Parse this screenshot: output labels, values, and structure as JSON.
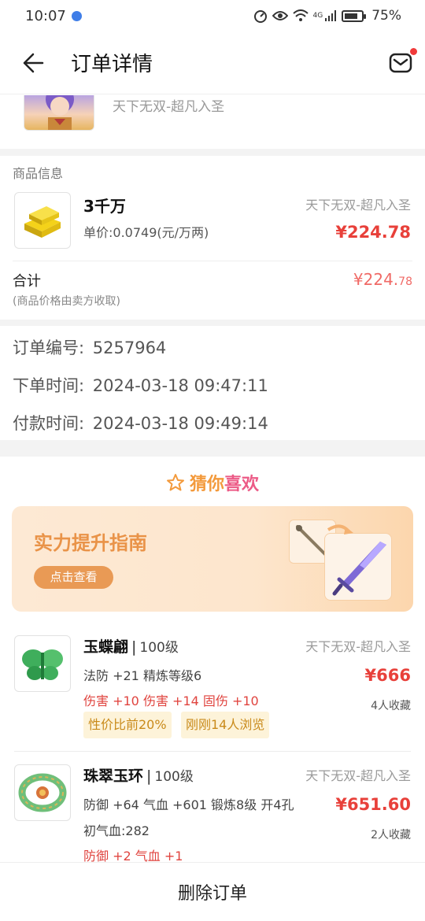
{
  "status_bar": {
    "time": "10:07",
    "network_label": "4G",
    "battery": "75%"
  },
  "nav": {
    "title": "订单详情"
  },
  "top_item": {
    "server": "天下无双-超凡入圣"
  },
  "goods": {
    "section_title": "商品信息",
    "name": "3千万",
    "unit_price": "单价:0.0749(元/万两)",
    "server": "天下无双-超凡入圣",
    "price": "¥224.78",
    "total_label": "合计",
    "total_note": "(商品价格由卖方收取)",
    "total_price_main": "¥224.",
    "total_price_decimal": "78"
  },
  "order": {
    "number_label": "订单编号:",
    "number_value": "5257964",
    "created_label": "下单时间:",
    "created_value": "2024-03-18 09:47:11",
    "paid_label": "付款时间:",
    "paid_value": "2024-03-18 09:49:14"
  },
  "recommend": {
    "title_part1": "猜你",
    "title_part2": "喜欢",
    "banner_title": "实力提升指南",
    "banner_button": "点击查看",
    "products": [
      {
        "name": "玉蝶翩",
        "level": "100级",
        "server": "天下无双-超凡入圣",
        "attr1": "法防 +21 精炼等级6",
        "attr2": "伤害 +10 伤害 +14 固伤 +10",
        "price": "¥666",
        "favorites": "4人收藏",
        "tags": [
          "性价比前20%",
          "刚刚14人浏览"
        ]
      },
      {
        "name": "珠翠玉环",
        "level": "100级",
        "server": "天下无双-超凡入圣",
        "attr1": "防御 +64 气血 +601 锻炼8级 开4孔",
        "attr2": "初气血:282",
        "attr3": "防御 +2 气血 +1",
        "price": "¥651.60",
        "favorites": "2人收藏"
      }
    ]
  },
  "bottom": {
    "delete_label": "删除订单"
  },
  "colors": {
    "price_red": "#e8403a",
    "accent_orange": "#e99348",
    "pink": "#ec5a86"
  }
}
